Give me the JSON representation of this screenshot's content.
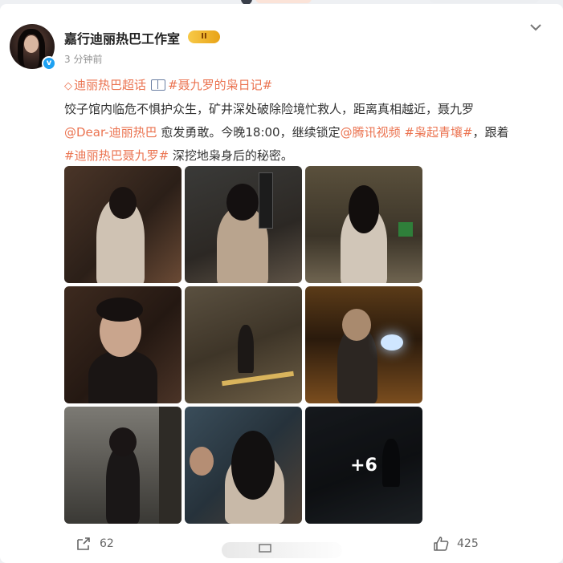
{
  "post": {
    "author": "嘉行迪丽热巴工作室",
    "vip_badge": "II",
    "verified_mark": "v",
    "time": "3 分钟前",
    "super_topic": "迪丽热巴超话",
    "book_tag": "#聂九罗的枭日记#",
    "text_1": "饺子馆内临危不惧护众生，矿井深处破除险境忙救人，距离真相越近，聂九罗",
    "mention": "@Dear-迪丽热巴",
    "text_2": " 愈发勇敢。今晚18:00，继续锁定",
    "mention_2": "@腾讯视频",
    "tag_2": " #枭起青壤#",
    "text_3": "，跟着",
    "tag_3": "#迪丽热巴聂九罗#",
    "text_4": " 深挖地枭身后的秘密。",
    "more_count": "+6"
  },
  "footer": {
    "repost_count": "62",
    "like_count": "425"
  },
  "icons": {
    "more_menu": "chevron-down-icon",
    "supertopic": "diamond-icon",
    "book": "book-icon",
    "repost": "share-icon",
    "like": "thumbs-up-icon"
  },
  "colors": {
    "accent": "#eb7350",
    "verified": "#1da1f2",
    "vip_gold": "#f7c948"
  }
}
